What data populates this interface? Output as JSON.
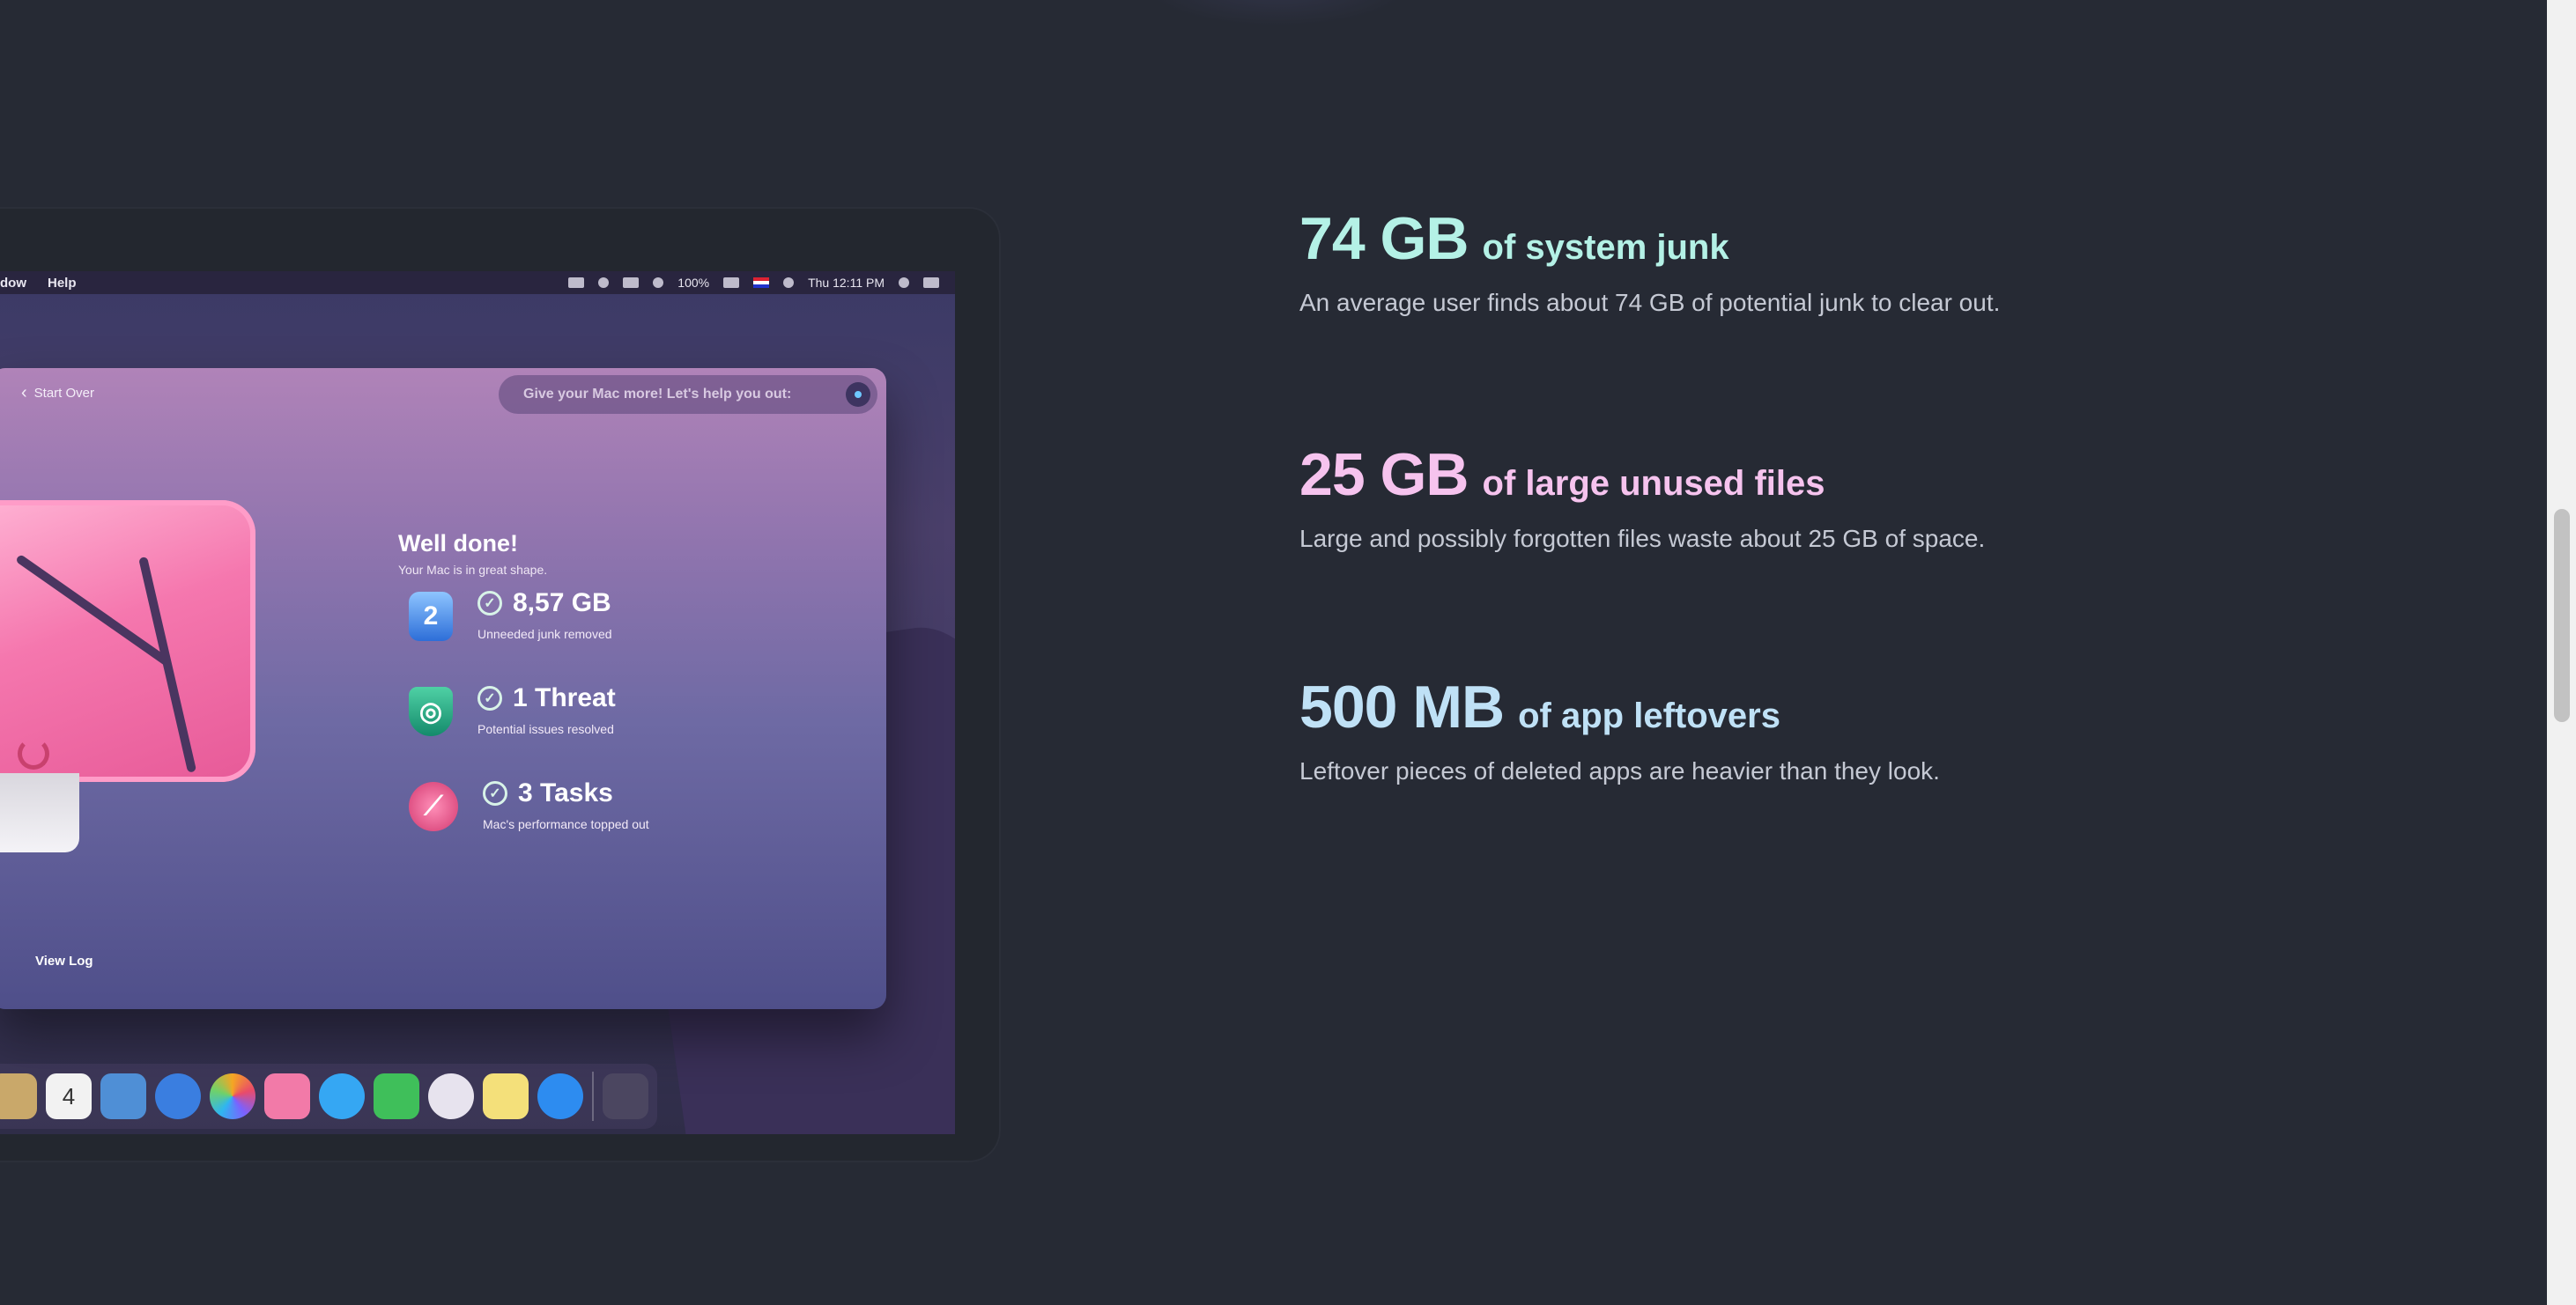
{
  "menubar": {
    "left_items": [
      "dow",
      "Help"
    ],
    "battery": "100%",
    "clock": "Thu 12:11 PM"
  },
  "app": {
    "back_label": "Start Over",
    "promo_text": "Give your Mac more! Let's help you out:",
    "heading": "Well done!",
    "subheading": "Your Mac is in great shape.",
    "stats": [
      {
        "icon": "hard-drive-icon",
        "value": "8,57 GB",
        "label": "Unneeded junk removed"
      },
      {
        "icon": "shield-fingerprint-icon",
        "value": "1 Threat",
        "label": "Potential issues resolved"
      },
      {
        "icon": "speed-gauge-icon",
        "value": "3 Tasks",
        "label": "Mac's performance topped out"
      }
    ],
    "view_log_label": "View Log",
    "check_glyph": "✓"
  },
  "dock": {
    "calendar_day": "4"
  },
  "features": [
    {
      "value": "74 GB",
      "suffix": "of system junk",
      "body": "An average user finds about 74 GB of potential junk to clear out.",
      "color": "#b4f1e6"
    },
    {
      "value": "25 GB",
      "suffix": "of large unused files",
      "body": "Large and possibly forgotten files waste about 25 GB of space.",
      "color": "#f6c3ee"
    },
    {
      "value": "500 MB",
      "suffix": "of app leftovers",
      "body": "Leftover pieces of deleted apps are heavier than they look.",
      "color": "#bfe1f6"
    }
  ],
  "colors": {
    "page_background": "#262a34",
    "body_text": "#c5c9d4"
  }
}
